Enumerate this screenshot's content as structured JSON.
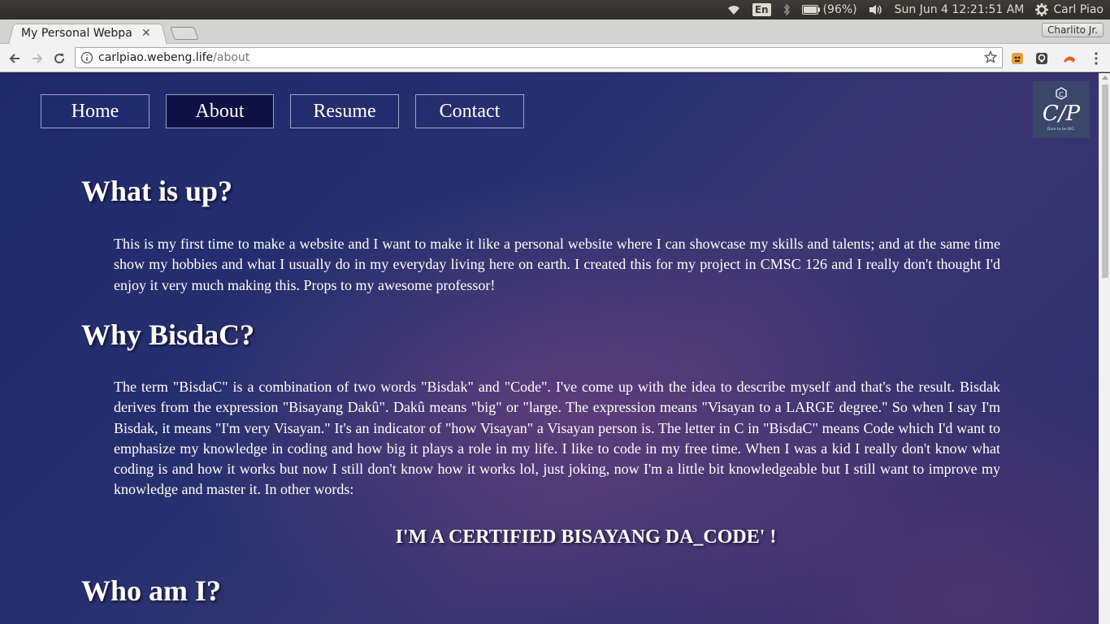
{
  "system_panel": {
    "language": "En",
    "battery_label": "(96%)",
    "datetime": "Sun Jun  4 12:21:51 AM",
    "user_name": "Carl Piao"
  },
  "browser": {
    "tab_title": "My Personal Webpa",
    "profile_name": "Charlito Jr.",
    "url_host": "carlpiao.webeng.life",
    "url_path": "/about"
  },
  "nav": {
    "home": "Home",
    "about": "About",
    "resume": "Resume",
    "contact": "Contact"
  },
  "logo": {
    "badge": "C",
    "initials": "C/P",
    "tagline": "Dare to be BIG."
  },
  "sections": {
    "s1_heading": "What is up?",
    "s1_text": "This is my first time to make a website and I want to make it like a personal website where I can showcase my skills and talents; and at the same time show my hobbies and what I usually do in my everyday living here on earth. I created this for my project in CMSC 126 and I really don't thought I'd enjoy it very much making this. Props to my awesome professor!",
    "s2_heading": "Why BisdaC?",
    "s2_text": "The term \"BisdaC\" is a combination of two words \"Bisdak\" and \"Code\". I've come up with the idea to describe myself and that's the result. Bisdak derives from the expression \"Bisayang Dakû\". Dakû means \"big\" or \"large. The expression means \"Visayan to a LARGE degree.\" So when I say I'm Bisdak, it means \"I'm very Visayan.\" It's an indicator of \"how Visayan\" a Visayan person is. The letter in C in \"BisdaC\" means Code which I'd want to emphasize my knowledge in coding and how big it plays a role in my life. I like to code in my free time. When I was a kid I really don't know what coding is and how it works but now I still don't know how it works lol, just joking, now I'm a little bit knowledgeable but I still want to improve my knowledge and master it. In other words:",
    "tagline": "I'M A CERTIFIED BISAYANG DA_CODE' !",
    "s3_heading": "Who am I?"
  }
}
